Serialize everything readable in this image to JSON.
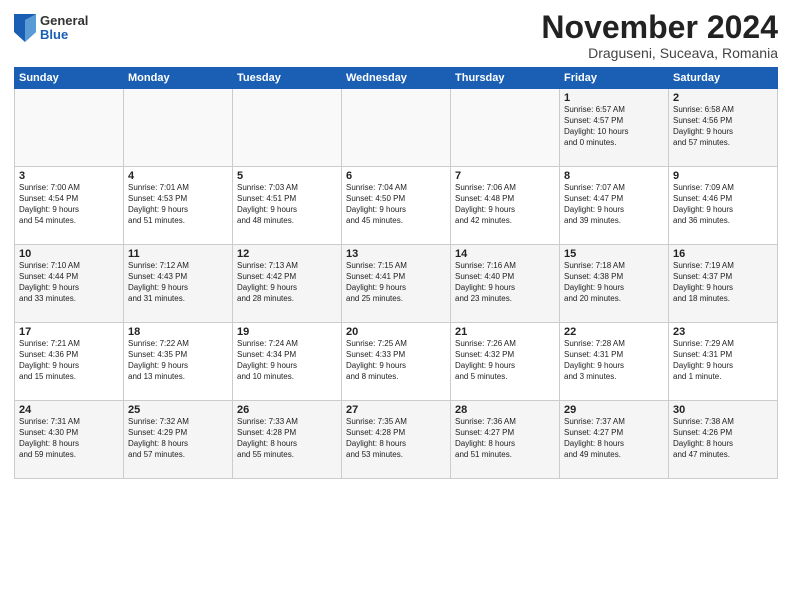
{
  "logo": {
    "general": "General",
    "blue": "Blue"
  },
  "title": "November 2024",
  "subtitle": "Draguseni, Suceava, Romania",
  "days_of_week": [
    "Sunday",
    "Monday",
    "Tuesday",
    "Wednesday",
    "Thursday",
    "Friday",
    "Saturday"
  ],
  "weeks": [
    [
      {
        "day": "",
        "info": ""
      },
      {
        "day": "",
        "info": ""
      },
      {
        "day": "",
        "info": ""
      },
      {
        "day": "",
        "info": ""
      },
      {
        "day": "",
        "info": ""
      },
      {
        "day": "1",
        "info": "Sunrise: 6:57 AM\nSunset: 4:57 PM\nDaylight: 10 hours\nand 0 minutes."
      },
      {
        "day": "2",
        "info": "Sunrise: 6:58 AM\nSunset: 4:56 PM\nDaylight: 9 hours\nand 57 minutes."
      }
    ],
    [
      {
        "day": "3",
        "info": "Sunrise: 7:00 AM\nSunset: 4:54 PM\nDaylight: 9 hours\nand 54 minutes."
      },
      {
        "day": "4",
        "info": "Sunrise: 7:01 AM\nSunset: 4:53 PM\nDaylight: 9 hours\nand 51 minutes."
      },
      {
        "day": "5",
        "info": "Sunrise: 7:03 AM\nSunset: 4:51 PM\nDaylight: 9 hours\nand 48 minutes."
      },
      {
        "day": "6",
        "info": "Sunrise: 7:04 AM\nSunset: 4:50 PM\nDaylight: 9 hours\nand 45 minutes."
      },
      {
        "day": "7",
        "info": "Sunrise: 7:06 AM\nSunset: 4:48 PM\nDaylight: 9 hours\nand 42 minutes."
      },
      {
        "day": "8",
        "info": "Sunrise: 7:07 AM\nSunset: 4:47 PM\nDaylight: 9 hours\nand 39 minutes."
      },
      {
        "day": "9",
        "info": "Sunrise: 7:09 AM\nSunset: 4:46 PM\nDaylight: 9 hours\nand 36 minutes."
      }
    ],
    [
      {
        "day": "10",
        "info": "Sunrise: 7:10 AM\nSunset: 4:44 PM\nDaylight: 9 hours\nand 33 minutes."
      },
      {
        "day": "11",
        "info": "Sunrise: 7:12 AM\nSunset: 4:43 PM\nDaylight: 9 hours\nand 31 minutes."
      },
      {
        "day": "12",
        "info": "Sunrise: 7:13 AM\nSunset: 4:42 PM\nDaylight: 9 hours\nand 28 minutes."
      },
      {
        "day": "13",
        "info": "Sunrise: 7:15 AM\nSunset: 4:41 PM\nDaylight: 9 hours\nand 25 minutes."
      },
      {
        "day": "14",
        "info": "Sunrise: 7:16 AM\nSunset: 4:40 PM\nDaylight: 9 hours\nand 23 minutes."
      },
      {
        "day": "15",
        "info": "Sunrise: 7:18 AM\nSunset: 4:38 PM\nDaylight: 9 hours\nand 20 minutes."
      },
      {
        "day": "16",
        "info": "Sunrise: 7:19 AM\nSunset: 4:37 PM\nDaylight: 9 hours\nand 18 minutes."
      }
    ],
    [
      {
        "day": "17",
        "info": "Sunrise: 7:21 AM\nSunset: 4:36 PM\nDaylight: 9 hours\nand 15 minutes."
      },
      {
        "day": "18",
        "info": "Sunrise: 7:22 AM\nSunset: 4:35 PM\nDaylight: 9 hours\nand 13 minutes."
      },
      {
        "day": "19",
        "info": "Sunrise: 7:24 AM\nSunset: 4:34 PM\nDaylight: 9 hours\nand 10 minutes."
      },
      {
        "day": "20",
        "info": "Sunrise: 7:25 AM\nSunset: 4:33 PM\nDaylight: 9 hours\nand 8 minutes."
      },
      {
        "day": "21",
        "info": "Sunrise: 7:26 AM\nSunset: 4:32 PM\nDaylight: 9 hours\nand 5 minutes."
      },
      {
        "day": "22",
        "info": "Sunrise: 7:28 AM\nSunset: 4:31 PM\nDaylight: 9 hours\nand 3 minutes."
      },
      {
        "day": "23",
        "info": "Sunrise: 7:29 AM\nSunset: 4:31 PM\nDaylight: 9 hours\nand 1 minute."
      }
    ],
    [
      {
        "day": "24",
        "info": "Sunrise: 7:31 AM\nSunset: 4:30 PM\nDaylight: 8 hours\nand 59 minutes."
      },
      {
        "day": "25",
        "info": "Sunrise: 7:32 AM\nSunset: 4:29 PM\nDaylight: 8 hours\nand 57 minutes."
      },
      {
        "day": "26",
        "info": "Sunrise: 7:33 AM\nSunset: 4:28 PM\nDaylight: 8 hours\nand 55 minutes."
      },
      {
        "day": "27",
        "info": "Sunrise: 7:35 AM\nSunset: 4:28 PM\nDaylight: 8 hours\nand 53 minutes."
      },
      {
        "day": "28",
        "info": "Sunrise: 7:36 AM\nSunset: 4:27 PM\nDaylight: 8 hours\nand 51 minutes."
      },
      {
        "day": "29",
        "info": "Sunrise: 7:37 AM\nSunset: 4:27 PM\nDaylight: 8 hours\nand 49 minutes."
      },
      {
        "day": "30",
        "info": "Sunrise: 7:38 AM\nSunset: 4:26 PM\nDaylight: 8 hours\nand 47 minutes."
      }
    ]
  ]
}
